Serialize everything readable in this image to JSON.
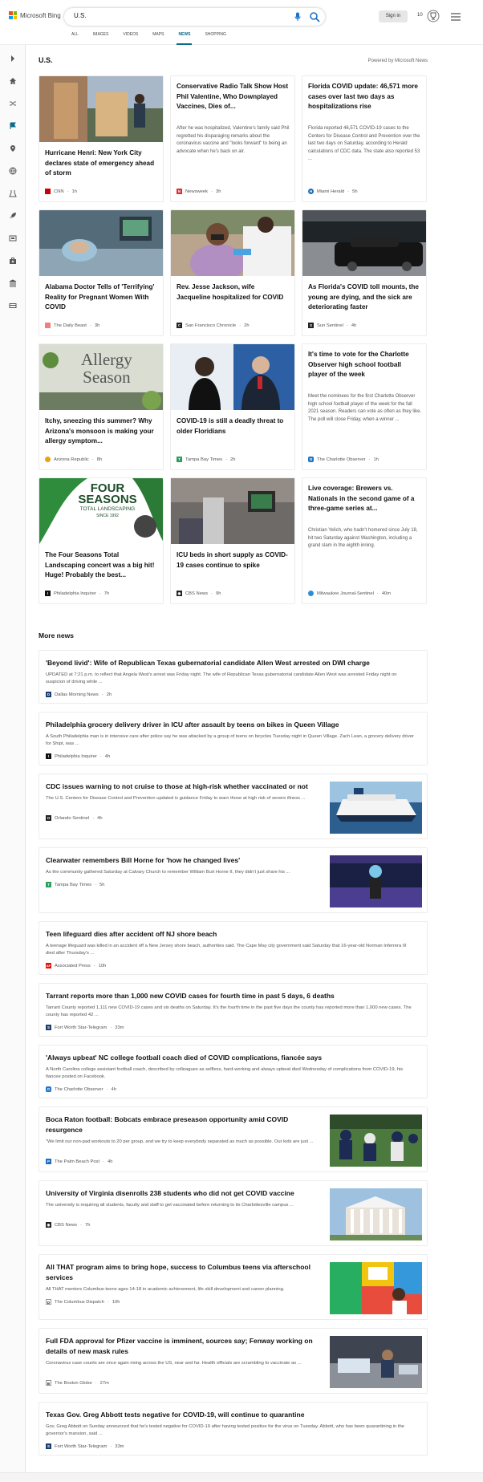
{
  "header": {
    "logo_text": "Microsoft Bing",
    "query": "U.S.",
    "signin_label": "Sign in",
    "points": "10"
  },
  "tabs": [
    {
      "label": "ALL"
    },
    {
      "label": "IMAGES"
    },
    {
      "label": "VIDEOS"
    },
    {
      "label": "MAPS"
    },
    {
      "label": "NEWS"
    },
    {
      "label": "SHOPPING"
    }
  ],
  "rail_icons": [
    "expand-icon",
    "home-icon",
    "shuffle-icon",
    "flag-icon",
    "location-icon",
    "globe-icon",
    "science-icon",
    "rocket-icon",
    "movies-icon",
    "medical-icon",
    "government-icon",
    "money-icon"
  ],
  "section": {
    "title": "U.S.",
    "powered": "Powered by Microsoft News"
  },
  "cards": [
    {
      "title": "Hurricane Henri: New York City declares state of emergency ahead of storm",
      "source": "CNN",
      "time": "1h"
    },
    {
      "title": "Conservative Radio Talk Show Host Phil Valentine, Who Downplayed Vaccines, Dies of...",
      "excerpt": "After he was hospitalized, Valentine's family said Phil regretted his disparaging remarks about the coronavirus vaccine and \"looks forward\" to being an advocate when he's back on air.",
      "source": "Newsweek",
      "time": "3h"
    },
    {
      "title": "Florida COVID update: 46,571 more cases over last two days as hospitalizations rise",
      "excerpt": "Florida reported 46,571 COVID-19 cases to the Centers for Disease Control and Prevention over the last two days on Saturday, according to Herald calculations of CDC data. The state also reported 53 ...",
      "source": "Miami Herald",
      "time": "5h"
    },
    {
      "title": "Alabama Doctor Tells of 'Terrifying' Reality for Pregnant Women With COVID",
      "source": "The Daily Beast",
      "time": "3h"
    },
    {
      "title": "Rev. Jesse Jackson, wife Jacqueline hospitalized for COVID",
      "source": "San Francisco Chronicle",
      "time": "2h"
    },
    {
      "title": "As Florida's COVID toll mounts, the young are dying, and the sick are deteriorating faster",
      "source": "Sun Sentinel",
      "time": "4h"
    },
    {
      "title": "Itchy, sneezing this summer? Why Arizona's monsoon is making your allergy symptom...",
      "source": "Arizona Republic",
      "time": "8h",
      "img_text_1": "Allergy",
      "img_text_2": "Season"
    },
    {
      "title": "COVID-19 is still a deadly threat to older Floridians",
      "source": "Tampa Bay Times",
      "time": "2h"
    },
    {
      "title": "It's time to vote for the Charlotte Observer high school football player of the week",
      "excerpt": "Meet the nominees for the first Charlotte Observer high school football player of the week for the fall 2021 season. Readers can vote as often as they like. The poll will close Friday, when a winner ...",
      "source": "The Charlotte Observer",
      "time": "1h"
    },
    {
      "title": "The Four Seasons Total Landscaping concert was a big hit! Huge! Probably the best...",
      "source": "Philadelphia Inquirer",
      "time": "7h",
      "img_text_1": "FOUR",
      "img_text_2": "SEASONS",
      "img_text_3": "TOTAL LANDSCAPING",
      "img_text_4": "SINCE 1992"
    },
    {
      "title": "ICU beds in short supply as COVID-19 cases continue to spike",
      "source": "CBS News",
      "time": "9h"
    },
    {
      "title": "Live coverage: Brewers vs. Nationals in the second game of a three-game series at...",
      "excerpt": "Christian Yelich, who hadn't homered since July 18, hit two Saturday against Washington, including a grand slam in the eighth inning.",
      "source": "Milwaukee Journal-Sentinel",
      "time": "40m"
    }
  ],
  "more_news": {
    "title": "More news",
    "items": [
      {
        "title": "'Beyond livid': Wife of Republican Texas gubernatorial candidate Allen West arrested on DWI charge",
        "excerpt": "UPDATED at 7:21 p.m. to reflect that Angela West's arrest was Friday night. The wife of Republican Texas gubernatorial candidate Allen West was arrested Friday night on suspicion of driving while ...",
        "source": "Dallas Morning News",
        "time": "2h"
      },
      {
        "title": "Philadelphia grocery delivery driver in ICU after assault by teens on bikes in Queen Village",
        "excerpt": "A South Philadelphia man is in intensive care after police say he was attacked by a group of teens on bicycles Tuesday night in Queen Village. Zach Lean, a grocery delivery driver for Shipt, was ...",
        "source": "Philadelphia Inquirer",
        "time": "4h"
      },
      {
        "title": "CDC issues warning to not cruise to those at high-risk whether vaccinated or not",
        "excerpt": "The U.S. Centers for Disease Control and Prevention updated is guidance Friday to warn those at high risk of severe illness ...",
        "source": "Orlando Sentinel",
        "time": "4h"
      },
      {
        "title": "Clearwater remembers Bill Horne for 'how he changed lives'",
        "excerpt": "As the community gathered Saturday at Calvary Church to remember William Burt Horne II, they didn't just share his ...",
        "source": "Tampa Bay Times",
        "time": "5h"
      },
      {
        "title": "Teen lifeguard dies after accident off NJ shore beach",
        "excerpt": "A teenage lifeguard was killed in an accident off a New Jersey shore beach, authorities said. The Cape May city government said Saturday that 16-year-old Norman Inferrera III died after Thursday's ...",
        "source": "Associated Press",
        "time": "10h"
      },
      {
        "title": "Tarrant reports more than 1,000 new COVID cases for fourth time in past 5 days, 6 deaths",
        "excerpt": "Tarrant County reported 1,111 new COVID-19 cases and six deaths on Saturday. It's the fourth time in the past five days the county has reported more than 1,000 new cases. The county has reported 42 ...",
        "source": "Fort Worth Star-Telegram",
        "time": "33m"
      },
      {
        "title": "'Always upbeat' NC college football coach died of COVID complications, fiancée says",
        "excerpt": "A North Carolina college assistant football coach, described by colleagues as selfless, hard-working and always upbeat died Wednesday of complications from COVID-19, his fiancee posted on Facebook.",
        "source": "The Charlotte Observer",
        "time": "4h"
      },
      {
        "title": "Boca Raton football: Bobcats embrace preseason opportunity amid COVID resurgence",
        "excerpt": "\"We limit our non-pad workouts to 20 per group, and we try to keep everybody separated as much as possible. Our kids are just ...",
        "source": "The Palm Beach Post",
        "time": "4h"
      },
      {
        "title": "University of Virginia disenrolls 238 students who did not get COVID vaccine",
        "excerpt": "The university is requiring all students, faculty and staff to get vaccinated before returning to its Charlottesville campus ...",
        "source": "CBS News",
        "time": "7h"
      },
      {
        "title": "All THAT program aims to bring hope, success to Columbus teens via afterschool services",
        "excerpt": "All THAT mentors Columbus teens ages 14-18 in academic achievement, life skill development and career planning.",
        "source": "The Columbus Dispatch",
        "time": "10h"
      },
      {
        "title": "Full FDA approval for Pfizer vaccine is imminent, sources say; Fenway working on details of new mask rules",
        "excerpt": "Coronavirus case counts are once again rising across the US, near and far. Health officials are scrambling to vaccinate as ...",
        "source": "The Boston Globe",
        "time": "27m"
      },
      {
        "title": "Texas Gov. Greg Abbott tests negative for COVID-19, will continue to quarantine",
        "excerpt": "Gov. Greg Abbott on Sunday announced that he's tested negative for COVID-19 after having tested positive for the virus on Tuesday. Abbott, who has been quarantining in the governor's mansion, said ...",
        "source": "Fort Worth Star-Telegram",
        "time": "33m"
      }
    ]
  },
  "colors": {
    "accent": "#0b6a8a",
    "ms_red": "#f25022",
    "ms_green": "#7fba00",
    "ms_blue": "#00a4ef",
    "ms_yellow": "#ffb900"
  }
}
